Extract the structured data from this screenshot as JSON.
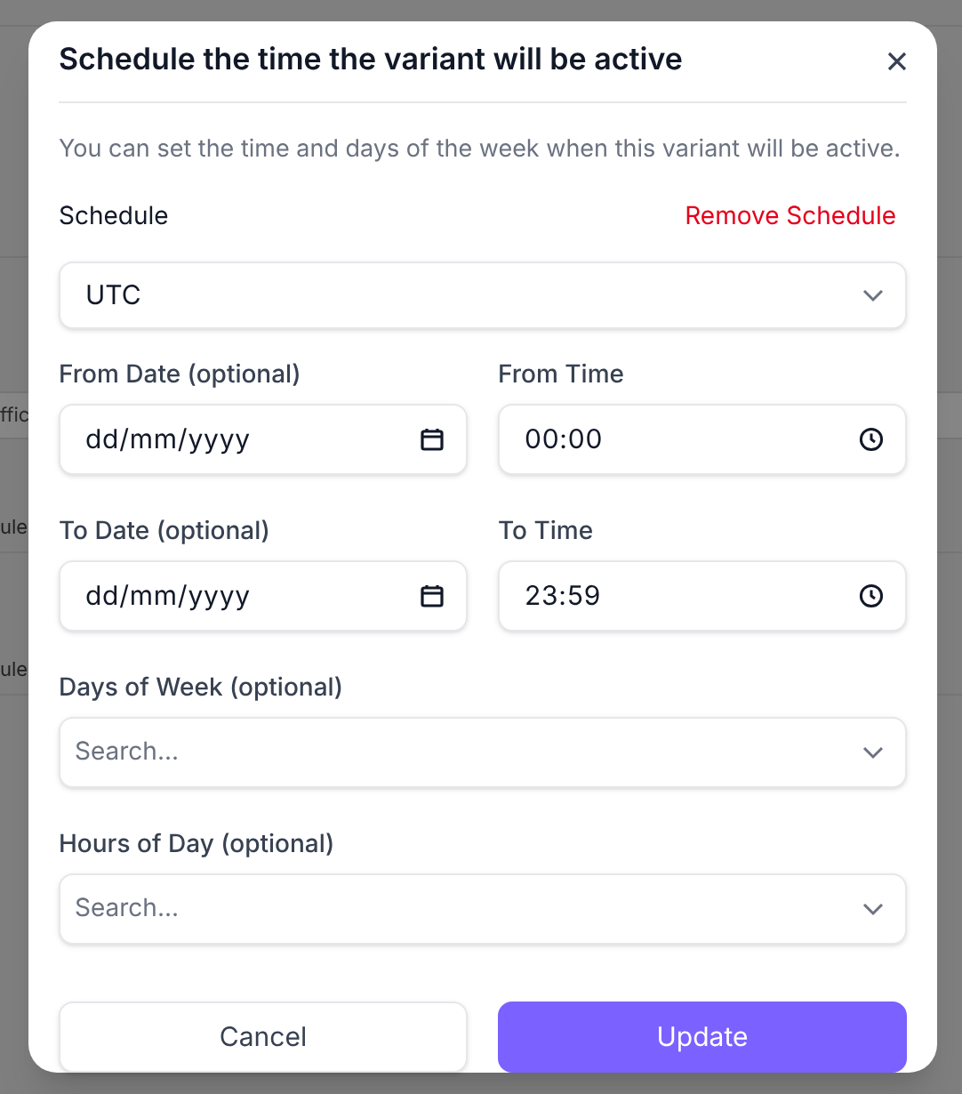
{
  "background": {
    "fragments": [
      "ffic",
      "ule",
      "ule"
    ]
  },
  "dialog": {
    "title": "Schedule the time the variant will be active",
    "description": "You can set the time and days of the week when this variant will be active.",
    "schedule": {
      "label": "Schedule",
      "action": "Remove Schedule"
    },
    "timezone": {
      "value": "UTC"
    },
    "fields": [
      {
        "label": "From Date (optional)",
        "kind": "date",
        "value": "dd/mm/yyyy"
      },
      {
        "label": "From Time",
        "kind": "time",
        "value": "00:00"
      },
      {
        "label": "To Date (optional)",
        "kind": "date",
        "value": "dd/mm/yyyy"
      },
      {
        "label": "To Time",
        "kind": "time",
        "value": "23:59"
      },
      {
        "label": "Days of Week (optional)",
        "kind": "multiselect",
        "placeholder": "Search..."
      },
      {
        "label": "Hours of Day (optional)",
        "kind": "multiselect",
        "placeholder": "Search..."
      }
    ],
    "buttons": [
      {
        "label": "Cancel",
        "kind": "secondary"
      },
      {
        "label": "Update",
        "kind": "primary"
      }
    ]
  }
}
